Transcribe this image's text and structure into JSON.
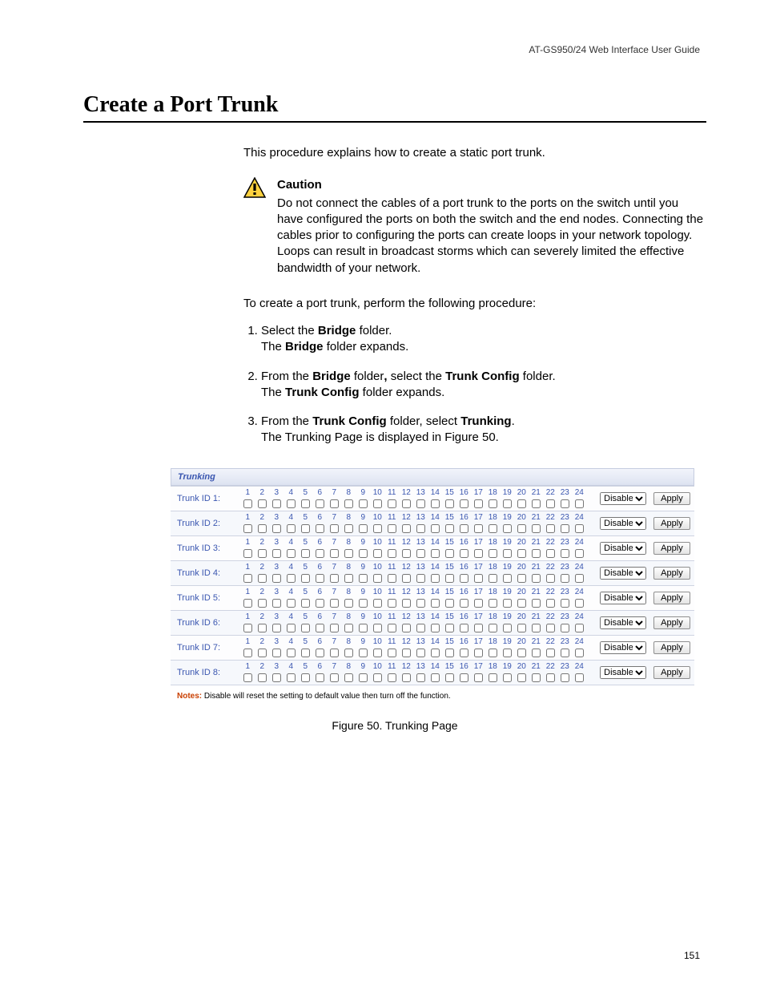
{
  "runningHead": "AT-GS950/24  Web Interface User Guide",
  "pageNum": "151",
  "heading": "Create a Port Trunk",
  "intro": "This procedure explains how to create a static port trunk.",
  "cautionHead": "Caution",
  "cautionBody": "Do not connect the cables of a port trunk to the ports on the switch until you have configured the ports on both the switch and the end nodes. Connecting the cables prior to configuring the ports can create loops in your network topology. Loops can result in broadcast storms which can severely limited the effective bandwidth of your network.",
  "lead": "To create a port trunk, perform the following procedure:",
  "step1a": "Select the ",
  "step1b": "Bridge",
  "step1c": " folder.",
  "step1d": "The ",
  "step1e": "Bridge",
  "step1f": " folder expands.",
  "step2a": "From the ",
  "step2b": "Bridge",
  "step2c": " folder",
  "step2c2": ",",
  "step2d": " select the ",
  "step2e": "Trunk Config",
  "step2f": " folder.",
  "step2g": "The ",
  "step2h": "Trunk Config",
  "step2i": " folder expands.",
  "step3a": "From the ",
  "step3b": "Trunk Config",
  "step3c": " folder, select ",
  "step3d": "Trunking",
  "step3e": ".",
  "step3f": "The Trunking Page is displayed in Figure 50.",
  "shotTitle": "Trunking",
  "trunks": [
    {
      "label": "Trunk ID 1:"
    },
    {
      "label": "Trunk ID 2:"
    },
    {
      "label": "Trunk ID 3:"
    },
    {
      "label": "Trunk ID 4:"
    },
    {
      "label": "Trunk ID 5:"
    },
    {
      "label": "Trunk ID 6:"
    },
    {
      "label": "Trunk ID 7:"
    },
    {
      "label": "Trunk ID 8:"
    }
  ],
  "portHeaders": [
    "1",
    "2",
    "3",
    "4",
    "5",
    "6",
    "7",
    "8",
    "9",
    "10",
    "11",
    "12",
    "13",
    "14",
    "15",
    "16",
    "17",
    "18",
    "19",
    "20",
    "21",
    "22",
    "23",
    "24"
  ],
  "selectValue": "Disable",
  "applyLabel": "Apply",
  "notesLabel": "Notes:",
  "notesText": " Disable will reset the setting to default value then turn off the function.",
  "figCaption": "Figure 50. Trunking Page"
}
